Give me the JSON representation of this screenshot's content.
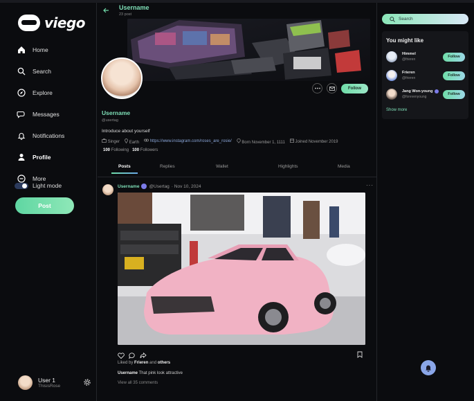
{
  "brand": {
    "name": "viego"
  },
  "nav": {
    "items": [
      {
        "label": "Home",
        "icon": "home-icon"
      },
      {
        "label": "Search",
        "icon": "search-icon"
      },
      {
        "label": "Explore",
        "icon": "compass-icon"
      },
      {
        "label": "Messages",
        "icon": "chat-icon"
      },
      {
        "label": "Notifications",
        "icon": "bell-icon"
      },
      {
        "label": "Profile",
        "icon": "user-icon"
      },
      {
        "label": "More",
        "icon": "more-icon"
      }
    ],
    "theme_toggle": "Light mode",
    "post_button": "Post"
  },
  "current_user": {
    "name": "User 1",
    "handle": "ThisisRose"
  },
  "header": {
    "name": "Username",
    "post_count": "23 post"
  },
  "profile": {
    "name": "Username",
    "handle": "@usertag",
    "bio": "Introduce about yourself",
    "occupation": "Singer",
    "location": "Earth",
    "link": "https://www.instagram.com/roses_are_rosie/",
    "born": "Born November 1, 1111",
    "joined": "Joined November 2019",
    "following_count": "100",
    "following_label": "Following",
    "followers_count": "100",
    "followers_label": "Followers",
    "follow_button": "Follow"
  },
  "tabs": [
    "Posts",
    "Replies",
    "Wallet",
    "Highlights",
    "Media"
  ],
  "post": {
    "author": "Username",
    "handle": "@Usertag",
    "date": "· Nov 10, 2024",
    "liked_prefix": "Liked by",
    "liked_user": "Frieren",
    "liked_and": "and",
    "liked_others": "others",
    "caption_user": "Username",
    "caption_text": "That pink look attractive",
    "comments_link": "View all 35 comments"
  },
  "right": {
    "search_label": "Search",
    "suggest_title": "You might like",
    "suggestions": [
      {
        "name": "Himmel",
        "handle": "@frieren",
        "follow": "Follow",
        "verified": false
      },
      {
        "name": "Frieren",
        "handle": "@frieren",
        "follow": "Follow",
        "verified": false
      },
      {
        "name": "Jang Won-young",
        "handle": "@forevenyoung",
        "follow": "Follow",
        "verified": true
      }
    ],
    "show_more": "Show more"
  },
  "colors": {
    "accent": "#7fe0b8",
    "accent_gradient_start": "#6fdca8",
    "background": "#0b0c0f",
    "verified": "#7b7be8"
  }
}
